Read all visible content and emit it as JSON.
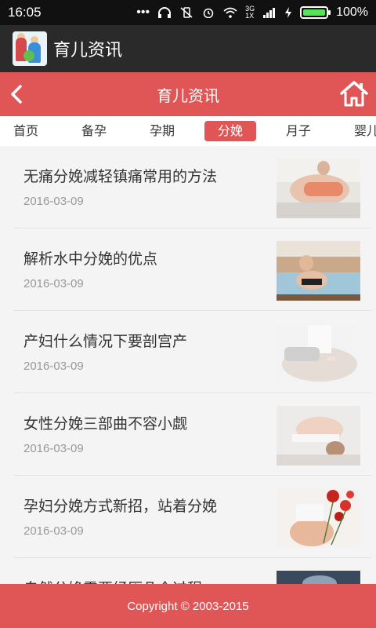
{
  "statusbar": {
    "time": "16:05",
    "network_label": "3G",
    "network_sub": "1X",
    "battery": "100%",
    "battery_level": 1.0
  },
  "app": {
    "title": "育儿资讯"
  },
  "nav": {
    "title": "育儿资讯",
    "colors": {
      "primary": "#e05555",
      "appbar": "#2a2a2a"
    }
  },
  "tabs": [
    {
      "label": "首页",
      "active": false
    },
    {
      "label": "备孕",
      "active": false
    },
    {
      "label": "孕期",
      "active": false
    },
    {
      "label": "分娩",
      "active": true
    },
    {
      "label": "月子",
      "active": false
    },
    {
      "label": "婴儿",
      "active": false
    }
  ],
  "articles": [
    {
      "title": "无痛分娩减轻镇痛常用的方法",
      "date": "2016-03-09"
    },
    {
      "title": "解析水中分娩的优点",
      "date": "2016-03-09"
    },
    {
      "title": "产妇什么情况下要剖宫产",
      "date": "2016-03-09"
    },
    {
      "title": "女性分娩三部曲不容小觑",
      "date": "2016-03-09"
    },
    {
      "title": "孕妇分娩方式新招，站着分娩",
      "date": "2016-03-09"
    },
    {
      "title": "自然分娩需要经历几个过程",
      "date": ""
    }
  ],
  "footer": {
    "copyright": "Copyright © 2003-2015"
  }
}
